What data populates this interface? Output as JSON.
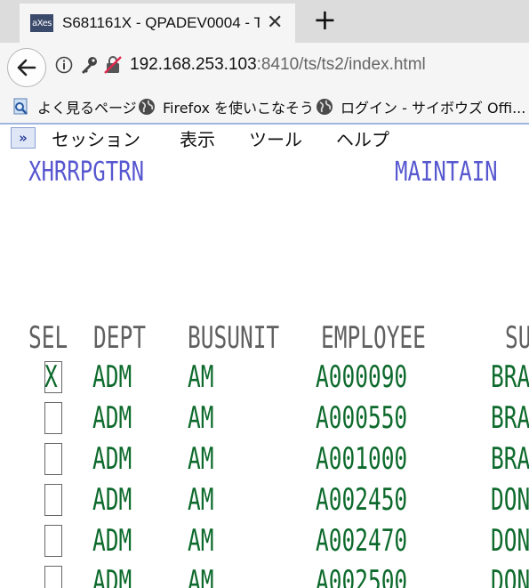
{
  "browser": {
    "tab_title": "S681161X - QPADEV0004 - T",
    "favicon_text": "aXes",
    "tab_close": "✕",
    "new_tab": "+",
    "url_host": "192.168.253.103",
    "url_rest": ":8410/ts/ts2/index.html"
  },
  "bookmarks": [
    {
      "label": "よく見るページ",
      "icon": "search-page-icon"
    },
    {
      "label": "Firefox を使いこなそう",
      "icon": "globe-icon"
    },
    {
      "label": "ログイン - サイボウズ Offi...",
      "icon": "globe-icon"
    }
  ],
  "app_menu": [
    "セッション",
    "表示",
    "ツール",
    "ヘルプ"
  ],
  "app_menu_icon": "»",
  "screen": {
    "program": "XHRRPGTRN",
    "title": "MAINTAIN",
    "headers": {
      "sel": "SEL",
      "dept": "DEPT",
      "busunit": "BUSUNIT",
      "employee": "EMPLOYEE",
      "su": "SU"
    },
    "rows": [
      {
        "sel": "X",
        "dept": "ADM",
        "busunit": "AM",
        "employee": "A000090",
        "surname": "BRA"
      },
      {
        "sel": "",
        "dept": "ADM",
        "busunit": "AM",
        "employee": "A000550",
        "surname": "BRA"
      },
      {
        "sel": "",
        "dept": "ADM",
        "busunit": "AM",
        "employee": "A001000",
        "surname": "BRA"
      },
      {
        "sel": "",
        "dept": "ADM",
        "busunit": "AM",
        "employee": "A002450",
        "surname": "DON"
      },
      {
        "sel": "",
        "dept": "ADM",
        "busunit": "AM",
        "employee": "A002470",
        "surname": "DON"
      },
      {
        "sel": "",
        "dept": "ADM",
        "busunit": "AM",
        "employee": "A002500",
        "surname": "DON"
      }
    ]
  },
  "colors": {
    "title": "#5757d0",
    "data": "#0d6a2c",
    "header": "#606060"
  }
}
